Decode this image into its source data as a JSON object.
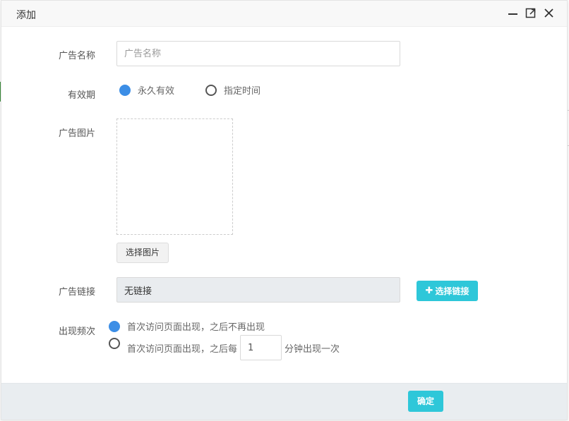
{
  "dialog": {
    "title": "添加"
  },
  "form": {
    "name": {
      "label": "广告名称",
      "placeholder": "广告名称",
      "value": ""
    },
    "validity": {
      "label": "有效期",
      "options": [
        {
          "label": "永久有效",
          "checked": true
        },
        {
          "label": "指定时间",
          "checked": false
        }
      ]
    },
    "image": {
      "label": "广告图片",
      "select_button": "选择图片"
    },
    "link": {
      "label": "广告链接",
      "value": "无链接",
      "select_button": "选择链接"
    },
    "frequency": {
      "label": "出现频次",
      "option1": "首次访问页面出现，之后不再出现",
      "option2_prefix": "首次访问页面出现，之后每",
      "option2_value": "1",
      "option2_suffix": "分钟出现一次"
    }
  },
  "footer": {
    "confirm": "确定"
  },
  "colors": {
    "accent": "#2ec7d9",
    "radio_checked": "#3c8ee6",
    "footer_bg": "#e9edf0"
  }
}
